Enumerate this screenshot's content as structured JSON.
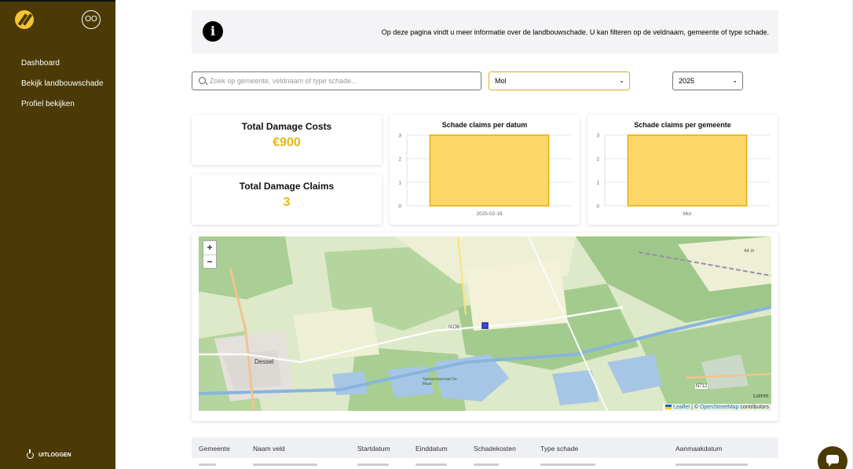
{
  "sidebar": {
    "avatar": "OO",
    "items": [
      {
        "label": "Dashboard"
      },
      {
        "label": "Bekijk landbouwschade"
      },
      {
        "label": "Profiel bekijken"
      }
    ],
    "logout": "UITLOGGEN"
  },
  "info": {
    "text": "Op deze pagina vindt u meer informatie over de landbouwschade. U kan filteren op de veldnaam, gemeente of type schade."
  },
  "filters": {
    "search_placeholder": "Zoek op gemeente, veldnaam of type schade...",
    "gemeente_selected": "Mol",
    "year_selected": "2025"
  },
  "stats": {
    "costs_title": "Total Damage Costs",
    "costs_value": "€900",
    "claims_title": "Total Damage Claims",
    "claims_value": "3"
  },
  "chart_data": [
    {
      "type": "bar",
      "title": "Schade claims per datum",
      "categories": [
        "2025-02-18"
      ],
      "values": [
        3
      ],
      "ylim": [
        0,
        3
      ],
      "yticks": [
        "0",
        "1",
        "2",
        "3"
      ],
      "bar_color": "#fdd868",
      "bar_stroke": "#e5ad06"
    },
    {
      "type": "bar",
      "title": "Schade claims per gemeente",
      "categories": [
        "Mol"
      ],
      "values": [
        3
      ],
      "ylim": [
        0,
        3
      ],
      "yticks": [
        "0",
        "1",
        "2",
        "3"
      ],
      "bar_color": "#fdd868",
      "bar_stroke": "#e5ad06"
    }
  ],
  "map": {
    "zoom_in": "+",
    "zoom_out": "−",
    "labels": {
      "town": "Dessel",
      "road_n136": "N136",
      "road_n712": "N712",
      "lommel": "Lomm",
      "peak": "44 m",
      "natuur": "Natuurreservaat De Maat"
    },
    "attribution_leaflet": "Leaflet",
    "attribution_sep": " | © ",
    "attribution_osm": "OpenStreetMap",
    "attribution_tail": " contributors"
  },
  "table": {
    "headers": [
      "Gemeente",
      "Naam veld",
      "Startdatum",
      "Einddatum",
      "Schadekosten",
      "Type schade",
      "Aanmaakdatum"
    ]
  },
  "colors": {
    "sidebar": "#4b3a06",
    "accent": "#e8b716",
    "bar": "#fdd868"
  }
}
